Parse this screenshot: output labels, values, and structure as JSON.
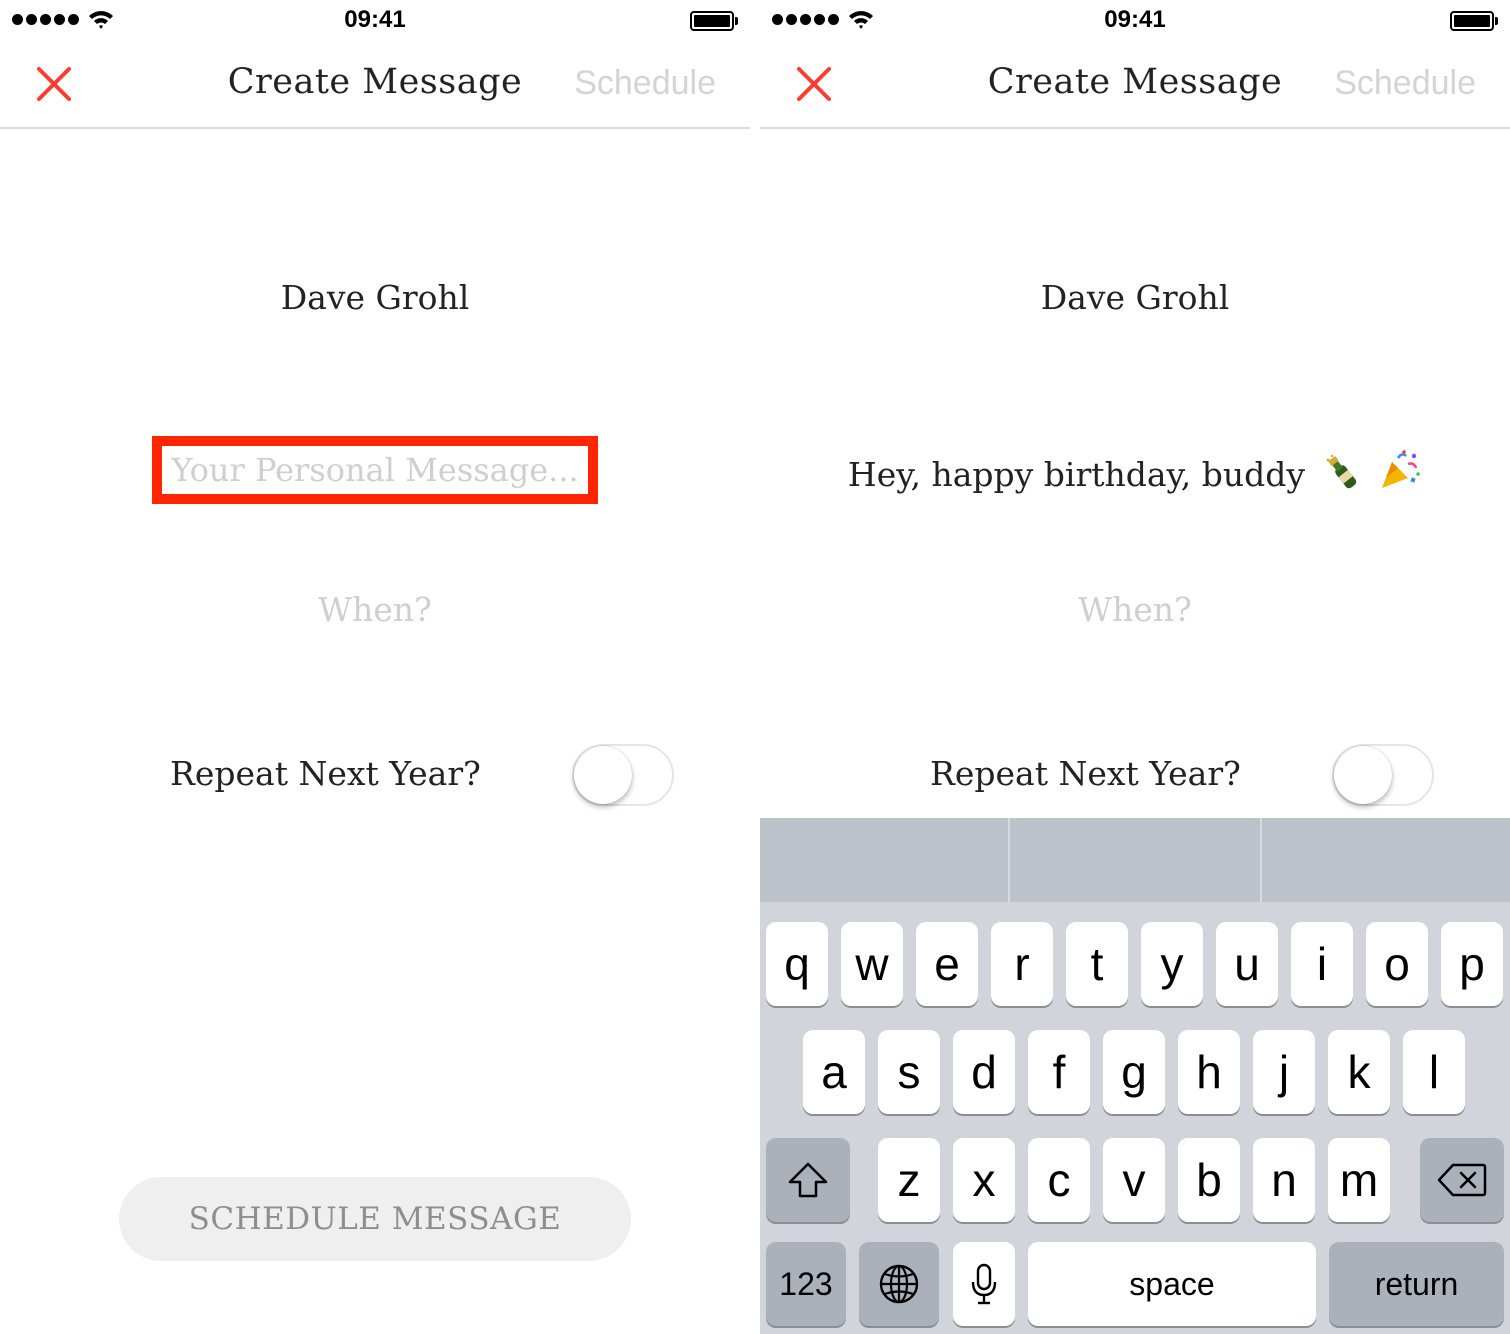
{
  "status_bar": {
    "time": "09:41"
  },
  "nav": {
    "title": "Create Message",
    "action_label": "Schedule"
  },
  "screens": {
    "left": {
      "recipient": "Dave Grohl",
      "message_placeholder": "Your Personal Message...",
      "when_placeholder": "When?",
      "repeat_label": "Repeat Next Year?",
      "repeat_on": false,
      "schedule_button_label": "SCHEDULE MESSAGE"
    },
    "right": {
      "recipient": "Dave Grohl",
      "message_text": "Hey, happy birthday, buddy",
      "message_emojis": [
        "champagne-bottle",
        "party-popper"
      ],
      "when_placeholder": "When?",
      "repeat_label": "Repeat Next Year?",
      "repeat_on": false
    }
  },
  "keyboard": {
    "row1": [
      "q",
      "w",
      "e",
      "r",
      "t",
      "y",
      "u",
      "i",
      "o",
      "p"
    ],
    "row2": [
      "a",
      "s",
      "d",
      "f",
      "g",
      "h",
      "j",
      "k",
      "l"
    ],
    "row3": [
      "z",
      "x",
      "c",
      "v",
      "b",
      "n",
      "m"
    ],
    "numbers_label": "123",
    "space_label": "space",
    "return_label": "return"
  },
  "colors": {
    "close_icon": "#ff3b30",
    "highlight_box": "#ff2600",
    "placeholder": "#cfcfcf",
    "schedule_disabled": "#d4d4d4",
    "keyboard_bg": "#d1d5db",
    "function_key": "#abb1ba"
  }
}
